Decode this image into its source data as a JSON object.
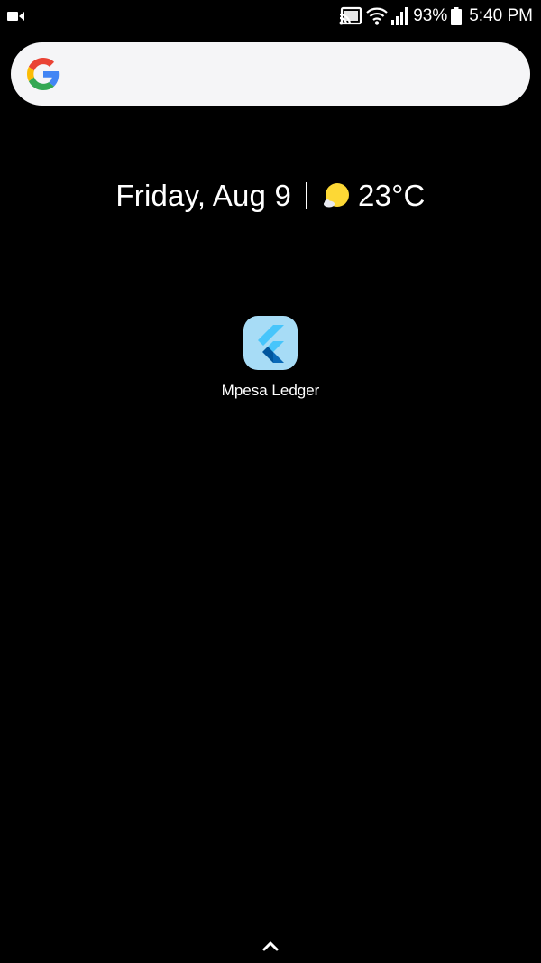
{
  "status_bar": {
    "left_icon": "video-camera-icon",
    "right_icons": [
      "cast-icon",
      "wifi-icon",
      "signal-icon",
      "battery-icon"
    ],
    "battery_percent": "93%",
    "time": "5:40 PM"
  },
  "search": {
    "logo": "google-g-icon"
  },
  "glance": {
    "date": "Friday, Aug 9",
    "weather_icon": "sunny-cloud-icon",
    "temperature": "23°C"
  },
  "apps": [
    {
      "label": "Mpesa Ledger",
      "icon": "flutter-icon"
    }
  ],
  "drawer": {
    "icon": "chevron-up-icon"
  },
  "colors": {
    "background": "#000000",
    "search_bg": "#f5f5f7",
    "app_icon_bg": "#a7dcf6",
    "flutter_light": "#47c5fb",
    "flutter_dark": "#00569e",
    "sun": "#fdd835"
  }
}
